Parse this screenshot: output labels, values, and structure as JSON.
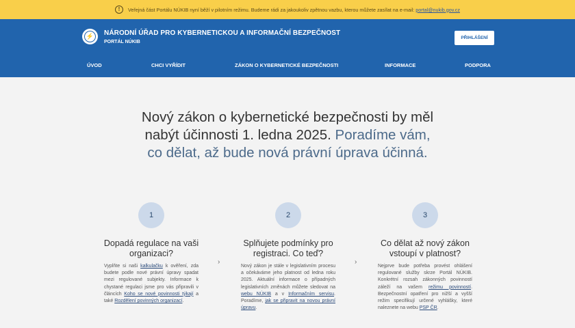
{
  "notice": {
    "icon": "warning-icon",
    "text": "Veřejná část Portálu NÚKIB nyní běží v pilotním režimu. Budeme rádi za jakoukoliv zpětnou vazbu, kterou můžete zasílat na e-mail:",
    "email": "portal@nukib.gov.cz"
  },
  "header": {
    "title": "NÁRODNÍ ÚŘAD PRO KYBERNETICKOU A INFORMAČNÍ BEZPEČNOST",
    "subtitle": "PORTÁL NÚKIB",
    "login": "PŘIHLÁŠENÍ"
  },
  "nav": [
    "ÚVOD",
    "CHCI VYŘÍDIT",
    "ZÁKON O KYBERNETICKÉ BEZPEČNOSTI",
    "INFORMACE",
    "PODPORA"
  ],
  "hero": {
    "line1": "Nový zákon o kybernetické bezpečnosti by měl",
    "line2a": "nabýt účinnosti 1. ledna 2025.",
    "line2b": "Poradíme vám,",
    "line3": "co dělat, až bude nová právní úprava účinná."
  },
  "steps": [
    {
      "number": "1",
      "title": "Dopadá regulace na vaši organizaci?",
      "t1": "Vyplňte si naši ",
      "l1": "kalkulačku",
      "t2": " k ověření, zda budete podle nové právní úpravy spadat mezi regulované subjekty. Informace k chystané regulaci jsme pro vás připravili v článcích ",
      "l2": "Koho se nové povinnosti týkají",
      "t3": " a také ",
      "l3": "Rozdělení povinných organizací",
      "t4": "."
    },
    {
      "number": "2",
      "title": "Splňujete podmínky pro registraci. Co teď?",
      "t1": "Nový zákon je stále v legislativním procesu a očekáváme jeho platnost od ledna roku 2025. Aktuální informace o případných legislativních změnách můžete sledovat na ",
      "l1": "webu NÚKIB",
      "t2": " a v ",
      "l2": "Informačním servisu",
      "t3": ". Poradíme, ",
      "l3": "jak se připravit na novou právní úpravu",
      "t4": "."
    },
    {
      "number": "3",
      "title": "Co dělat až nový zákon vstoupí v platnost?",
      "t1": "Nejprve bude potřeba provést ohlášení regulované služby skrze Portál NÚKIB. Konkrétní rozsah zákonných povinností záleží na vašem ",
      "l1": "režimu povinností",
      "t2": ". Bezpečnostní opatření pro nižší a vyšší režim specifikují určené vyhlášky, které naleznete na webu ",
      "l2": "PSP ČR",
      "t3": ".",
      "l3": "",
      "t4": ""
    }
  ]
}
